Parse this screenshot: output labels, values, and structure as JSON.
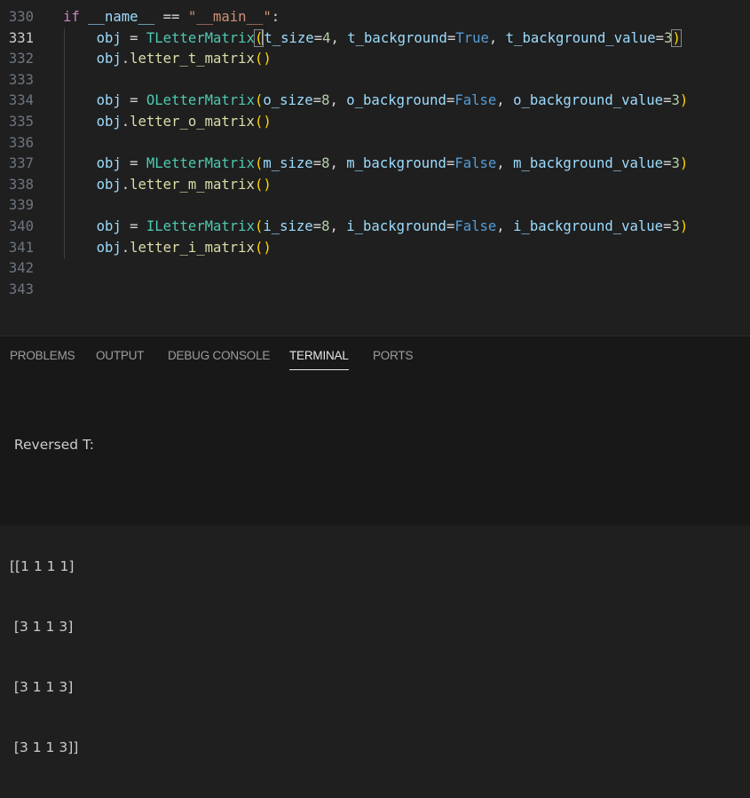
{
  "editor": {
    "lines": [
      {
        "num": "330",
        "code": [
          {
            "t": "if ",
            "c": "kw"
          },
          {
            "t": "__name__",
            "c": "var"
          },
          {
            "t": " == ",
            "c": "op"
          },
          {
            "t": "\"__main__\"",
            "c": "str"
          },
          {
            "t": ":",
            "c": "op"
          }
        ]
      },
      {
        "num": "331",
        "active": true,
        "code": [
          {
            "t": "    "
          },
          {
            "t": "obj",
            "c": "var"
          },
          {
            "t": " = ",
            "c": "op"
          },
          {
            "t": "TLetterMatrix",
            "c": "cls"
          },
          {
            "t": "(",
            "c": "br1 brm"
          },
          {
            "t": "cursor",
            "c": "cursor"
          },
          {
            "t": "t_size",
            "c": "var"
          },
          {
            "t": "=",
            "c": "op"
          },
          {
            "t": "4",
            "c": "num"
          },
          {
            "t": ", ",
            "c": "op"
          },
          {
            "t": "t_background",
            "c": "var"
          },
          {
            "t": "=",
            "c": "op"
          },
          {
            "t": "True",
            "c": "const"
          },
          {
            "t": ", ",
            "c": "op"
          },
          {
            "t": "t_background_value",
            "c": "var"
          },
          {
            "t": "=",
            "c": "op"
          },
          {
            "t": "3",
            "c": "num"
          },
          {
            "t": ")",
            "c": "br1 brm"
          }
        ]
      },
      {
        "num": "332",
        "code": [
          {
            "t": "    "
          },
          {
            "t": "obj",
            "c": "var"
          },
          {
            "t": ".",
            "c": "op"
          },
          {
            "t": "letter_t_matrix",
            "c": "fn"
          },
          {
            "t": "()",
            "c": "br1"
          }
        ]
      },
      {
        "num": "333",
        "code": []
      },
      {
        "num": "334",
        "code": [
          {
            "t": "    "
          },
          {
            "t": "obj",
            "c": "var"
          },
          {
            "t": " = ",
            "c": "op"
          },
          {
            "t": "OLetterMatrix",
            "c": "cls"
          },
          {
            "t": "(",
            "c": "br1"
          },
          {
            "t": "o_size",
            "c": "var"
          },
          {
            "t": "=",
            "c": "op"
          },
          {
            "t": "8",
            "c": "num"
          },
          {
            "t": ", ",
            "c": "op"
          },
          {
            "t": "o_background",
            "c": "var"
          },
          {
            "t": "=",
            "c": "op"
          },
          {
            "t": "False",
            "c": "const"
          },
          {
            "t": ", ",
            "c": "op"
          },
          {
            "t": "o_background_value",
            "c": "var"
          },
          {
            "t": "=",
            "c": "op"
          },
          {
            "t": "3",
            "c": "num"
          },
          {
            "t": ")",
            "c": "br1"
          }
        ]
      },
      {
        "num": "335",
        "code": [
          {
            "t": "    "
          },
          {
            "t": "obj",
            "c": "var"
          },
          {
            "t": ".",
            "c": "op"
          },
          {
            "t": "letter_o_matrix",
            "c": "fn"
          },
          {
            "t": "()",
            "c": "br1"
          }
        ]
      },
      {
        "num": "336",
        "code": []
      },
      {
        "num": "337",
        "code": [
          {
            "t": "    "
          },
          {
            "t": "obj",
            "c": "var"
          },
          {
            "t": " = ",
            "c": "op"
          },
          {
            "t": "MLetterMatrix",
            "c": "cls"
          },
          {
            "t": "(",
            "c": "br1"
          },
          {
            "t": "m_size",
            "c": "var"
          },
          {
            "t": "=",
            "c": "op"
          },
          {
            "t": "8",
            "c": "num"
          },
          {
            "t": ", ",
            "c": "op"
          },
          {
            "t": "m_background",
            "c": "var"
          },
          {
            "t": "=",
            "c": "op"
          },
          {
            "t": "False",
            "c": "const"
          },
          {
            "t": ", ",
            "c": "op"
          },
          {
            "t": "m_background_value",
            "c": "var"
          },
          {
            "t": "=",
            "c": "op"
          },
          {
            "t": "3",
            "c": "num"
          },
          {
            "t": ")",
            "c": "br1"
          }
        ]
      },
      {
        "num": "338",
        "code": [
          {
            "t": "    "
          },
          {
            "t": "obj",
            "c": "var"
          },
          {
            "t": ".",
            "c": "op"
          },
          {
            "t": "letter_m_matrix",
            "c": "fn"
          },
          {
            "t": "()",
            "c": "br1"
          }
        ]
      },
      {
        "num": "339",
        "code": []
      },
      {
        "num": "340",
        "code": [
          {
            "t": "    "
          },
          {
            "t": "obj",
            "c": "var"
          },
          {
            "t": " = ",
            "c": "op"
          },
          {
            "t": "ILetterMatrix",
            "c": "cls"
          },
          {
            "t": "(",
            "c": "br1"
          },
          {
            "t": "i_size",
            "c": "var"
          },
          {
            "t": "=",
            "c": "op"
          },
          {
            "t": "8",
            "c": "num"
          },
          {
            "t": ", ",
            "c": "op"
          },
          {
            "t": "i_background",
            "c": "var"
          },
          {
            "t": "=",
            "c": "op"
          },
          {
            "t": "False",
            "c": "const"
          },
          {
            "t": ", ",
            "c": "op"
          },
          {
            "t": "i_background_value",
            "c": "var"
          },
          {
            "t": "=",
            "c": "op"
          },
          {
            "t": "3",
            "c": "num"
          },
          {
            "t": ")",
            "c": "br1"
          }
        ]
      },
      {
        "num": "341",
        "code": [
          {
            "t": "    "
          },
          {
            "t": "obj",
            "c": "var"
          },
          {
            "t": ".",
            "c": "op"
          },
          {
            "t": "letter_i_matrix",
            "c": "fn"
          },
          {
            "t": "()",
            "c": "br1"
          }
        ]
      },
      {
        "num": "342",
        "code": []
      },
      {
        "num": "343",
        "code": []
      }
    ]
  },
  "panel": {
    "tabs": [
      "PROBLEMS",
      "OUTPUT",
      "DEBUG CONSOLE",
      "TERMINAL",
      "PORTS"
    ],
    "active_tab": "TERMINAL",
    "terminal_lines": [
      " Reversed T:",
      "",
      "[[1 1 1 1]",
      " [3 1 1 3]",
      " [3 1 1 3]",
      " [3 1 1 3]]"
    ]
  },
  "colors": {
    "background": "#1f1f1f",
    "keyword": "#c586c0",
    "variable": "#9cdcfe",
    "class": "#4ec9b0",
    "function": "#dcdcaa",
    "number": "#b5cea8",
    "constant": "#569cd6",
    "string": "#ce9178",
    "bracket": "#ffd700"
  }
}
